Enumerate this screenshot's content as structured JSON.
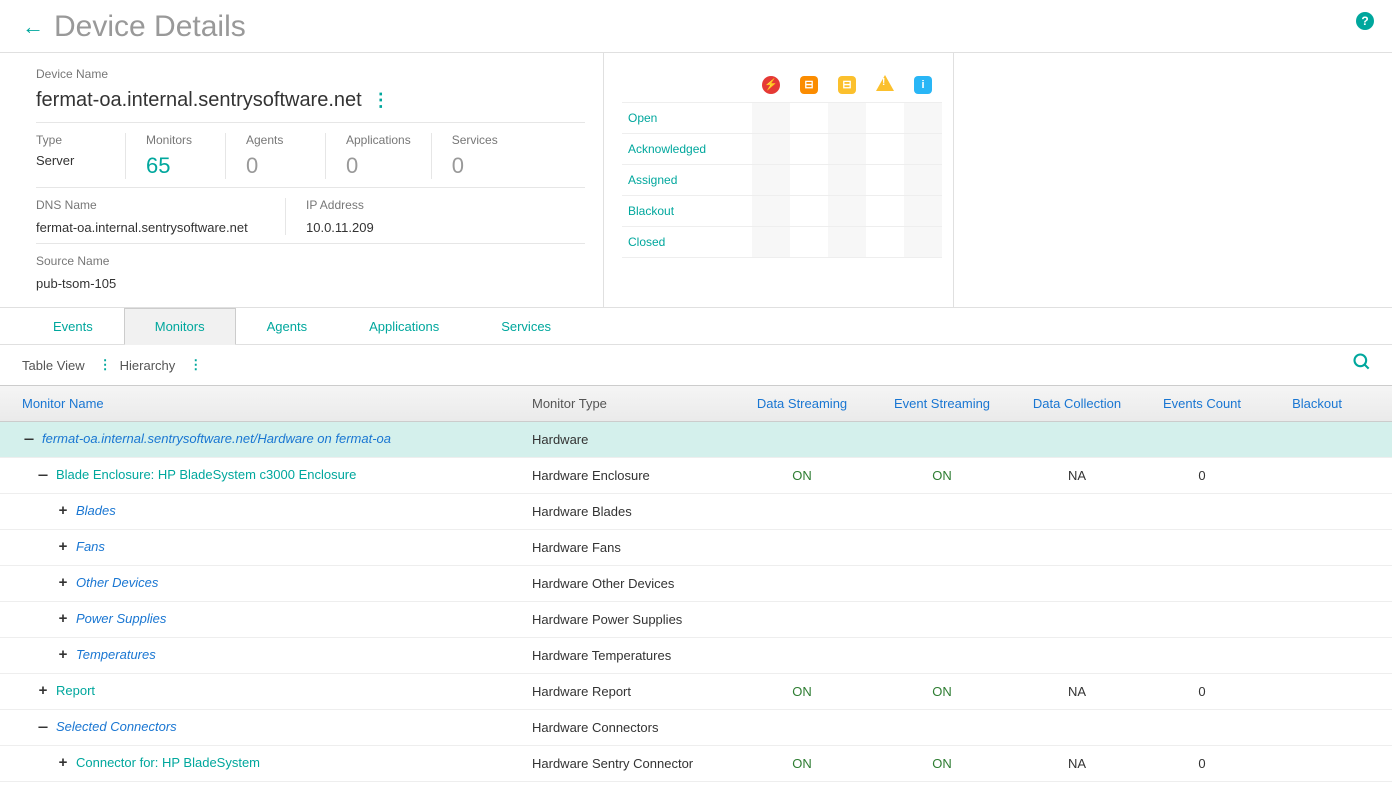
{
  "header": {
    "title": "Device Details"
  },
  "device": {
    "name_label": "Device Name",
    "name": "fermat-oa.internal.sentrysoftware.net",
    "type_label": "Type",
    "type": "Server",
    "monitors_label": "Monitors",
    "monitors": "65",
    "agents_label": "Agents",
    "agents": "0",
    "applications_label": "Applications",
    "applications": "0",
    "services_label": "Services",
    "services": "0",
    "dns_label": "DNS Name",
    "dns": "fermat-oa.internal.sentrysoftware.net",
    "ip_label": "IP Address",
    "ip": "10.0.11.209",
    "source_label": "Source Name",
    "source": "pub-tsom-105"
  },
  "event_rows": {
    "open": "Open",
    "ack": "Acknowledged",
    "assigned": "Assigned",
    "blackout": "Blackout",
    "closed": "Closed"
  },
  "tabs": {
    "events": "Events",
    "monitors": "Monitors",
    "agents": "Agents",
    "applications": "Applications",
    "services": "Services"
  },
  "view": {
    "table": "Table View",
    "hierarchy": "Hierarchy"
  },
  "columns": {
    "name": "Monitor Name",
    "type": "Monitor Type",
    "ds": "Data Streaming",
    "es": "Event Streaming",
    "dc": "Data Collection",
    "ec": "Events Count",
    "bl": "Blackout"
  },
  "tree": [
    {
      "indent": 0,
      "toggle": "—",
      "label": "fermat-oa.internal.sentrysoftware.net/Hardware on fermat-oa",
      "italic": true,
      "link": false,
      "type": "Hardware",
      "ds": "",
      "es": "",
      "dc": "",
      "ec": "",
      "highlighted": true
    },
    {
      "indent": 1,
      "toggle": "—",
      "label": "Blade Enclosure: HP BladeSystem c3000 Enclosure",
      "italic": false,
      "link": true,
      "type": "Hardware Enclosure",
      "ds": "ON",
      "es": "ON",
      "dc": "NA",
      "ec": "0"
    },
    {
      "indent": 2,
      "toggle": "+",
      "label": "Blades",
      "italic": true,
      "link": false,
      "type": "Hardware Blades",
      "ds": "",
      "es": "",
      "dc": "",
      "ec": ""
    },
    {
      "indent": 2,
      "toggle": "+",
      "label": "Fans",
      "italic": true,
      "link": false,
      "type": "Hardware Fans",
      "ds": "",
      "es": "",
      "dc": "",
      "ec": ""
    },
    {
      "indent": 2,
      "toggle": "+",
      "label": "Other Devices",
      "italic": true,
      "link": false,
      "type": "Hardware Other Devices",
      "ds": "",
      "es": "",
      "dc": "",
      "ec": ""
    },
    {
      "indent": 2,
      "toggle": "+",
      "label": "Power Supplies",
      "italic": true,
      "link": false,
      "type": "Hardware Power Supplies",
      "ds": "",
      "es": "",
      "dc": "",
      "ec": ""
    },
    {
      "indent": 2,
      "toggle": "+",
      "label": "Temperatures",
      "italic": true,
      "link": false,
      "type": "Hardware Temperatures",
      "ds": "",
      "es": "",
      "dc": "",
      "ec": ""
    },
    {
      "indent": 1,
      "toggle": "+",
      "label": "Report",
      "italic": false,
      "link": true,
      "type": "Hardware Report",
      "ds": "ON",
      "es": "ON",
      "dc": "NA",
      "ec": "0"
    },
    {
      "indent": 1,
      "toggle": "—",
      "label": "Selected Connectors",
      "italic": true,
      "link": false,
      "type": "Hardware Connectors",
      "ds": "",
      "es": "",
      "dc": "",
      "ec": ""
    },
    {
      "indent": 2,
      "toggle": "+",
      "label": "Connector for: HP BladeSystem",
      "italic": false,
      "link": true,
      "type": "Hardware Sentry Connector",
      "ds": "ON",
      "es": "ON",
      "dc": "NA",
      "ec": "0"
    }
  ]
}
